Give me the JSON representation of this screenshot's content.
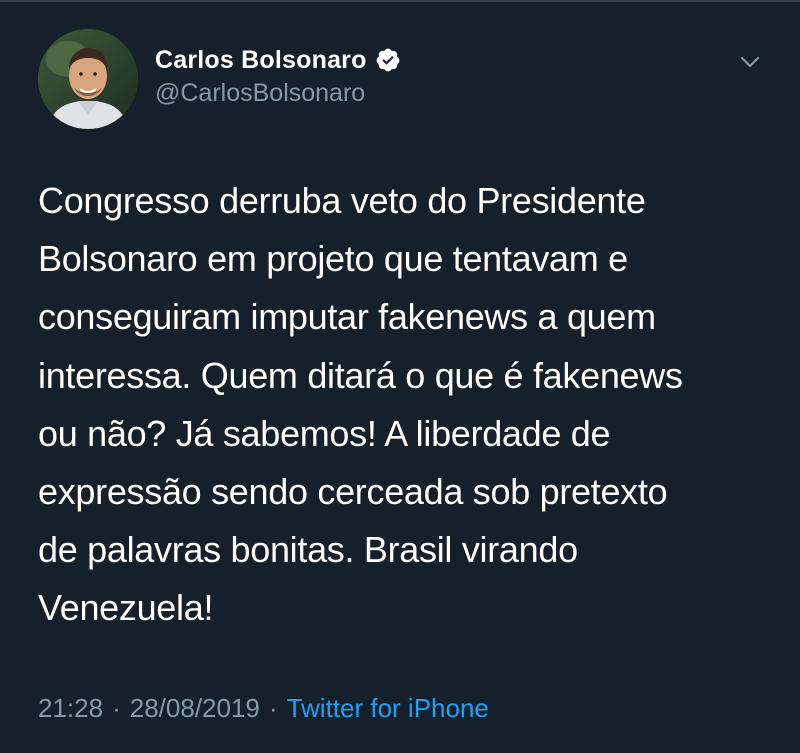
{
  "tweet": {
    "author": {
      "display_name": "Carlos Bolsonaro",
      "handle": "@CarlosBolsonaro",
      "verified": true,
      "avatar_icon": "profile-photo"
    },
    "menu_icon": "chevron-down-icon",
    "text": "Congresso derruba veto do Presidente\nBolsonaro em projeto que tentavam e\nconseguiram imputar fakenews a quem\ninteressa. Quem ditará o que é fakenews\nou não? Já sabemos! A liberdade de\nexpressão sendo cerceada sob pretexto\nde palavras bonitas. Brasil virando\nVenezuela!",
    "time": "21:28",
    "separator": "·",
    "date": "28/08/2019",
    "source": "Twitter for iPhone"
  },
  "colors": {
    "background": "#15202b",
    "text": "#ffffff",
    "muted": "#8899a6",
    "link": "#1da1f2"
  }
}
